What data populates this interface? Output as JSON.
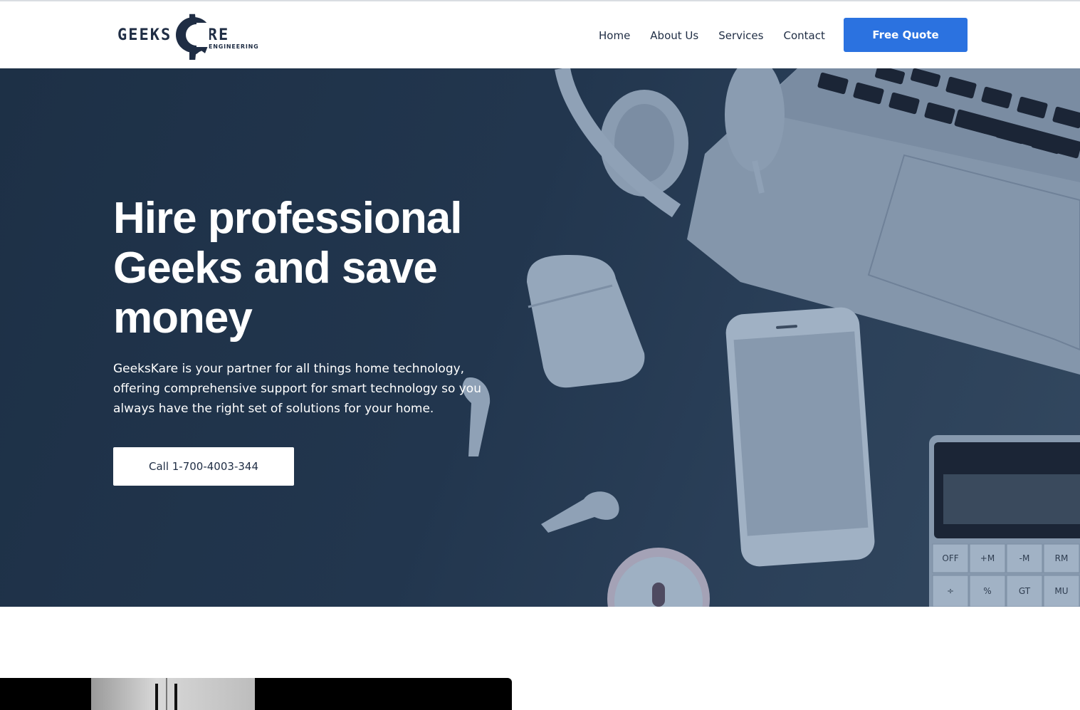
{
  "brand": {
    "name_left": "GEEKS",
    "name_right": "KARE",
    "tagline": "ENGINEERING"
  },
  "nav": {
    "items": [
      "Home",
      "About Us",
      "Services",
      "Contact"
    ],
    "cta_label": "Free Quote"
  },
  "hero": {
    "title": "Hire professional Geeks and save money",
    "description": "GeeksKare is your partner for all things home technology, offering comprehensive support for smart technology so you always have the right set of solutions for your home.",
    "call_label": "Call 1-700-4003-344"
  },
  "calculator_keys": [
    "OFF",
    "+M",
    "-M",
    "RM",
    "÷",
    "%",
    "GT",
    "MU"
  ],
  "colors": {
    "accent": "#2b72e0",
    "brand_dark": "#1f2d44",
    "hero_overlay": "#1d3046"
  }
}
